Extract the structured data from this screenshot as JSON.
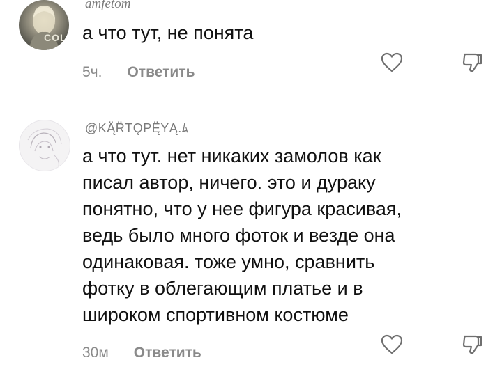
{
  "comments": [
    {
      "username": "amfetom",
      "avatar_tag": "COL",
      "text": "а что тут, не понята",
      "time": "5ч.",
      "reply_label": "Ответить",
      "like_icon": "heart-outline-icon",
      "dislike_icon": "thumbs-down-outline-icon"
    },
    {
      "username": "@KĄ̈R̈TǪPĘ̈YĄ.ﾑ",
      "text_lines": [
        "а что тут. нет никаких замолов как",
        "писал автор, ничего. это и дураку",
        "понятно, что у нее фигура красивая,",
        "ведь было много фоток и везде она",
        "одинаковая. тоже умно, сравнить",
        "фотку в облегающим платье и в",
        "широком спортивном костюме"
      ],
      "time": "30м",
      "reply_label": "Ответить",
      "like_icon": "heart-outline-icon",
      "dislike_icon": "thumbs-down-outline-icon"
    }
  ],
  "colors": {
    "text": "#111111",
    "muted": "#8a8a8a",
    "background": "#ffffff"
  }
}
